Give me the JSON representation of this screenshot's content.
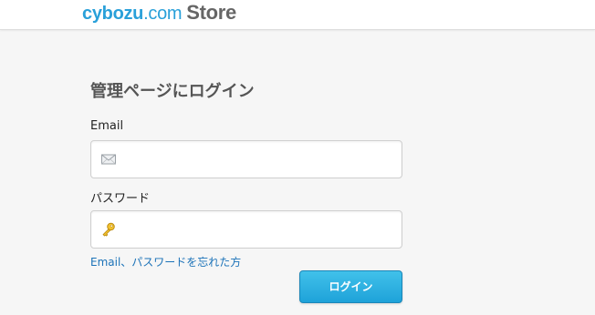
{
  "header": {
    "logo": {
      "part1": "cybozu",
      "part2": ".com",
      "part3": "Store"
    }
  },
  "login": {
    "title": "管理ページにログイン",
    "email_label": "Email",
    "email_value": "",
    "email_placeholder": "",
    "password_label": "パスワード",
    "password_value": "",
    "password_placeholder": "",
    "forgot_link": "Email、パスワードを忘れた方",
    "submit_label": "ログイン"
  },
  "icons": {
    "email": "envelope-icon",
    "password": "key-icon"
  },
  "colors": {
    "brand": "#29a0d9",
    "link": "#1b72b8",
    "button": "#1ea2d9"
  }
}
